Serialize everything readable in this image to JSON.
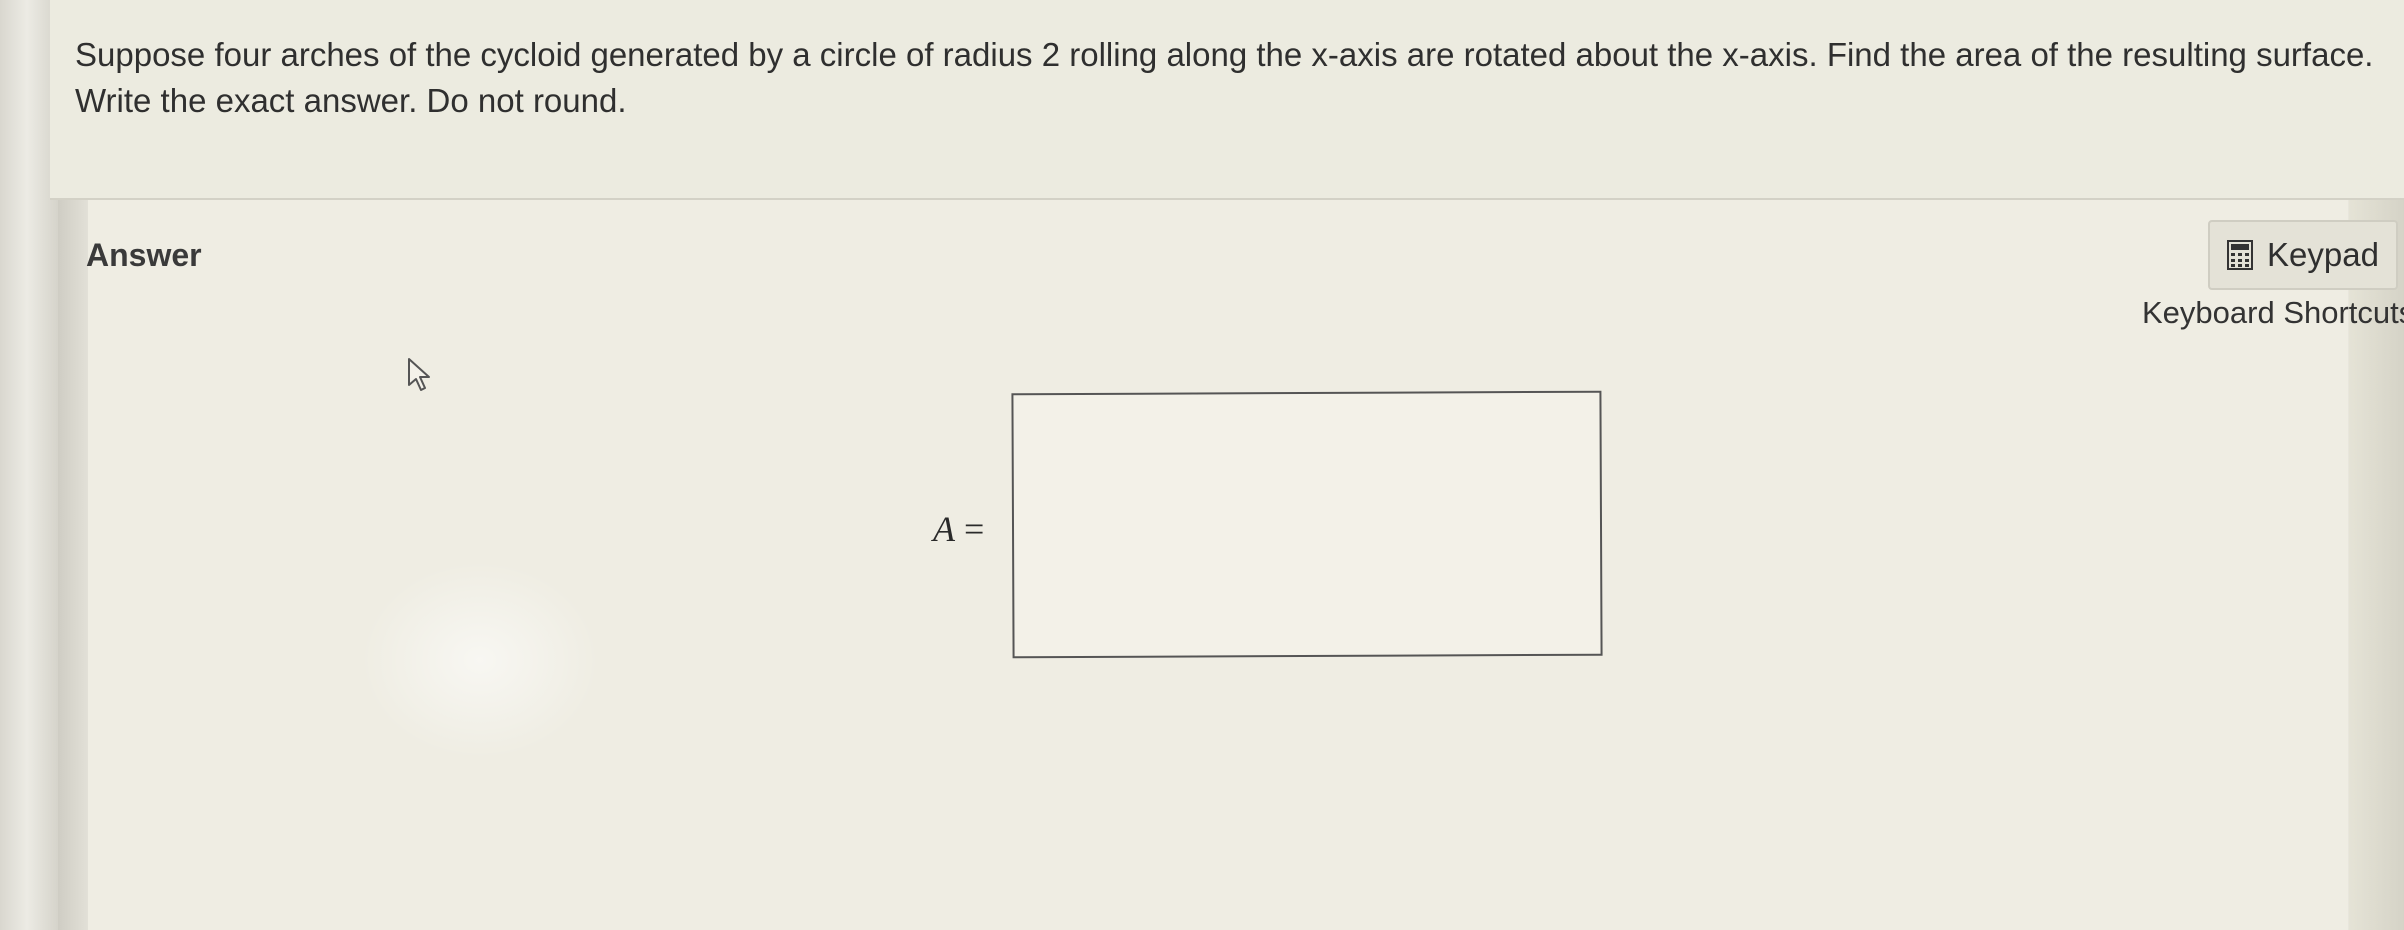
{
  "question": {
    "text": "Suppose four arches of the cycloid generated by a circle of radius 2 rolling along the x-axis are rotated about the x-axis. Find the area of the resulting surface. Write the exact answer. Do not round."
  },
  "answer": {
    "label": "Answer",
    "equation_variable": "A",
    "equation_sign": "=",
    "input_value": ""
  },
  "toolbar": {
    "keypad_label": "Keypad",
    "keyboard_shortcuts_label": "Keyboard Shortcuts"
  },
  "icons": {
    "keypad": "calculator-icon",
    "pointer": "cursor-icon"
  },
  "colors": {
    "background": "#efede3",
    "question_panel": "#ecebe0",
    "text": "#2f2f2f"
  }
}
